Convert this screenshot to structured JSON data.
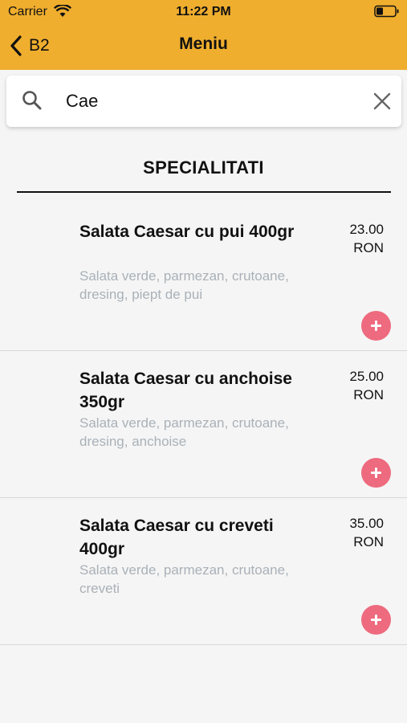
{
  "status_bar": {
    "carrier": "Carrier",
    "time": "11:22 PM"
  },
  "nav": {
    "back_label": "B2",
    "title": "Meniu"
  },
  "search": {
    "value": "Cae"
  },
  "section": {
    "title": "SPECIALITATI"
  },
  "items": [
    {
      "name": "Salata Caesar cu pui 400gr",
      "description": "Salata verde, parmezan, crutoane, dresing, piept de pui",
      "price": "23.00",
      "currency": "RON"
    },
    {
      "name": "Salata Caesar cu anchoise 350gr",
      "description": "Salata verde, parmezan, crutoane, dresing, anchoise",
      "price": "25.00",
      "currency": "RON"
    },
    {
      "name": "Salata Caesar cu creveti 400gr",
      "description": "Salata verde, parmezan, crutoane, creveti",
      "price": "35.00",
      "currency": "RON"
    }
  ],
  "icons": {
    "back": "chevron-left-icon",
    "search": "search-icon",
    "clear": "close-icon",
    "add": "plus-icon"
  },
  "colors": {
    "header": "#f0ae2e",
    "add_button": "#ee6a7e",
    "description": "#a9b1b8",
    "background": "#f5f5f5"
  }
}
